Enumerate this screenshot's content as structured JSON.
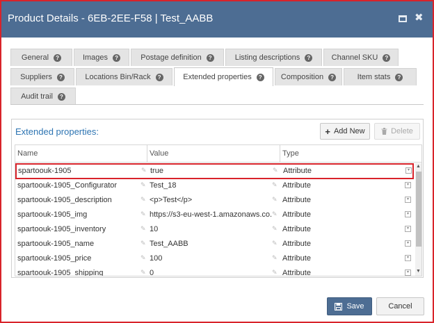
{
  "window": {
    "title": "Product Details - 6EB-2EE-F58 | Test_AABB",
    "maximize_icon": "maximize-icon",
    "close_icon": "close-icon",
    "close_glyph": "✖"
  },
  "tabs": [
    {
      "label": "General",
      "active": false
    },
    {
      "label": "Images",
      "active": false
    },
    {
      "label": "Postage definition",
      "active": false
    },
    {
      "label": "Listing descriptions",
      "active": false
    },
    {
      "label": "Channel SKU",
      "active": false
    },
    {
      "label": "Suppliers",
      "active": false
    },
    {
      "label": "Locations Bin/Rack",
      "active": false
    },
    {
      "label": "Extended properties",
      "active": true
    },
    {
      "label": "Composition",
      "active": false
    },
    {
      "label": "Item stats",
      "active": false
    },
    {
      "label": "Audit trail",
      "active": false
    }
  ],
  "help_glyph": "?",
  "panel": {
    "title": "Extended properties:",
    "add_label": "Add New",
    "add_glyph": "+",
    "delete_label": "Delete",
    "delete_icon": "trash-icon"
  },
  "grid": {
    "columns": [
      "Name",
      "Value",
      "Type"
    ],
    "rows": [
      {
        "name": "spartoouk-1905",
        "value": "true",
        "type": "Attribute",
        "selected": true
      },
      {
        "name": "spartoouk-1905_Configurator",
        "value": "Test_18",
        "type": "Attribute"
      },
      {
        "name": "spartoouk-1905_description",
        "value": "<p>Test</p>",
        "type": "Attribute"
      },
      {
        "name": "spartoouk-1905_img",
        "value": "https://s3-eu-west-1.amazonaws.co...",
        "type": "Attribute"
      },
      {
        "name": "spartoouk-1905_inventory",
        "value": "10",
        "type": "Attribute"
      },
      {
        "name": "spartoouk-1905_name",
        "value": "Test_AABB",
        "type": "Attribute"
      },
      {
        "name": "spartoouk-1905_price",
        "value": "100",
        "type": "Attribute"
      },
      {
        "name": "spartoouk-1905_shipping",
        "value": "0",
        "type": "Attribute"
      }
    ],
    "edit_glyph": "✎",
    "dropdown_glyph": "▾"
  },
  "footer": {
    "save_label": "Save",
    "cancel_label": "Cancel"
  },
  "colors": {
    "titlebar": "#4d6d93",
    "accent_text": "#2d74b2",
    "highlight": "#d8232a"
  }
}
